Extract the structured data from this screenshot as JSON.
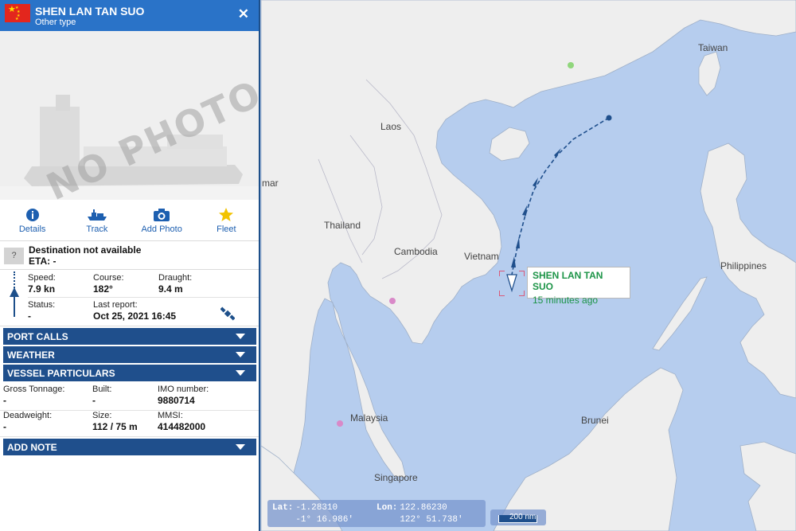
{
  "vessel": {
    "name": "SHEN LAN TAN SUO",
    "type": "Other type",
    "no_photo_text": "NO PHOTO"
  },
  "actions": [
    {
      "label": "Details",
      "icon": "info-icon"
    },
    {
      "label": "Track",
      "icon": "ship-icon"
    },
    {
      "label": "Add Photo",
      "icon": "camera-icon"
    },
    {
      "label": "Fleet",
      "icon": "star-icon"
    }
  ],
  "destination": {
    "qmark": "?",
    "text": "Destination not available",
    "eta": "ETA: -"
  },
  "voyage": {
    "speed_label": "Speed:",
    "speed": "7.9 kn",
    "course_label": "Course:",
    "course": "182°",
    "draught_label": "Draught:",
    "draught": "9.4 m",
    "status_label": "Status:",
    "status": "-",
    "report_label": "Last report:",
    "report": "Oct 25, 2021 16:45"
  },
  "sections": {
    "port_calls": "PORT CALLS",
    "weather": "WEATHER",
    "particulars": "VESSEL PARTICULARS",
    "add_note": "ADD NOTE"
  },
  "particulars": {
    "gt_label": "Gross Tonnage:",
    "gt": "-",
    "built_label": "Built:",
    "built": "-",
    "imo_label": "IMO number:",
    "imo": "9880714",
    "dwt_label": "Deadweight:",
    "dwt": "-",
    "size_label": "Size:",
    "size": "112 / 75 m",
    "mmsi_label": "MMSI:",
    "mmsi": "414482000"
  },
  "map": {
    "labels": {
      "taiwan": "Taiwan",
      "laos": "Laos",
      "thailand": "Thailand",
      "cambodia": "Cambodia",
      "vietnam": "Vietnam",
      "philippines": "Philippines",
      "malaysia": "Malaysia",
      "brunei": "Brunei",
      "singapore": "Singapore",
      "mar": "mar"
    },
    "popup": {
      "name": "SHEN LAN TAN SUO",
      "time": "15 minutes ago"
    },
    "coords": {
      "lat_label": "Lat:",
      "lat_dec": "-1.28310",
      "lat_dms": "-1° 16.986′",
      "lon_label": "Lon:",
      "lon_dec": "122.86230",
      "lon_dms": "122° 51.738′"
    },
    "scale": "200 nm"
  },
  "colors": {
    "header_blue": "#2a73c8",
    "section_blue": "#1f4f8c",
    "sea": "#b6cdee",
    "land": "#eeeeee",
    "status_green": "#1c9447"
  }
}
